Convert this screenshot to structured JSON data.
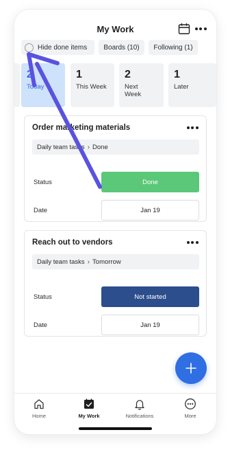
{
  "header": {
    "title": "My Work",
    "calendar_icon": "calendar-icon",
    "more_icon": "more-horizontal-icon"
  },
  "filters": {
    "hide_done": "Hide done items",
    "boards": "Boards (10)",
    "following": "Following (1)"
  },
  "day_tabs": [
    {
      "count": "2",
      "label": "Today",
      "active": true
    },
    {
      "count": "1",
      "label": "This Week"
    },
    {
      "count": "2",
      "label": "Next\nWeek"
    },
    {
      "count": "1",
      "label": "Later"
    }
  ],
  "items": [
    {
      "title": "Order marketing materials",
      "board": "Daily team tasks",
      "group": "Done",
      "status_label": "Status",
      "status": "Done",
      "status_color": "#5ac878",
      "date_label": "Date",
      "date": "Jan 19"
    },
    {
      "title": "Reach out to vendors",
      "board": "Daily team tasks",
      "group": "Tomorrow",
      "status_label": "Status",
      "status": "Not started",
      "status_color": "#2c4e8c",
      "date_label": "Date",
      "date": "Jan 19"
    }
  ],
  "fab": {
    "icon": "plus-icon"
  },
  "nav": [
    {
      "label": "Home",
      "icon": "home-icon"
    },
    {
      "label": "My Work",
      "icon": "my-work-icon",
      "active": true
    },
    {
      "label": "Notifications",
      "icon": "bell-icon"
    },
    {
      "label": "More",
      "icon": "more-circle-icon"
    }
  ],
  "colors": {
    "accent": "#2f6ee3",
    "active_tab_bg": "#cfe2fc",
    "chip_bg": "#f1f2f4",
    "annotation_arrow": "#5a52e0"
  }
}
